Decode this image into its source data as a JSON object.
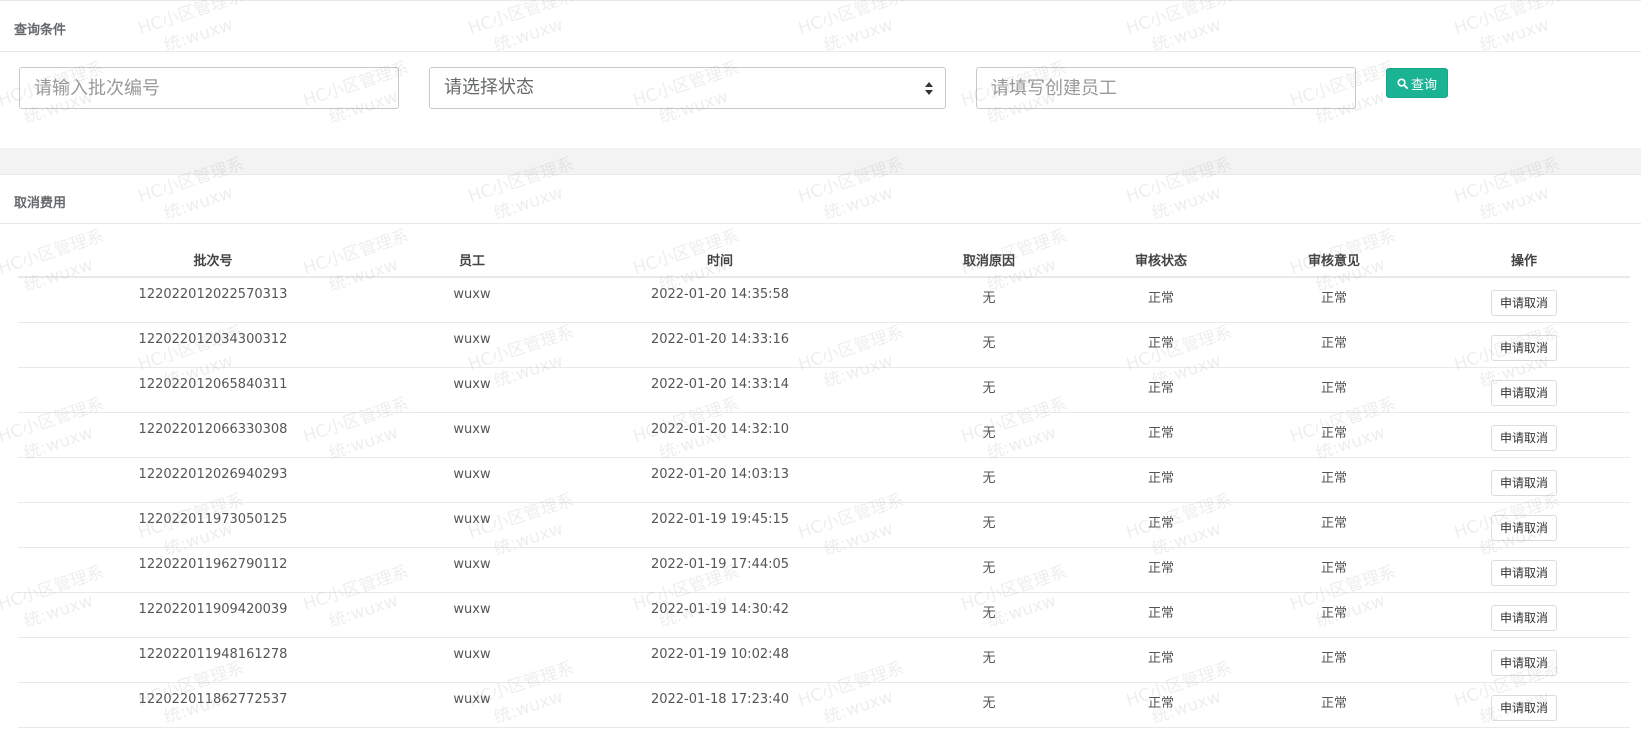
{
  "query_panel": {
    "title": "查询条件",
    "batch_placeholder": "请输入批次编号",
    "status_placeholder": "请选择状态",
    "creator_placeholder": "请填写创建员工",
    "query_button": "查询"
  },
  "cancel_panel": {
    "title": "取消费用",
    "columns": [
      "批次号",
      "员工",
      "时间",
      "取消原因",
      "审核状态",
      "审核意见",
      "操作"
    ],
    "rows": [
      {
        "batch": "122022012022570313",
        "staff": "wuxw",
        "time": "2022-01-20 14:35:58",
        "reason": "无",
        "status": "正常",
        "opinion": "正常",
        "action": "申请取消"
      },
      {
        "batch": "122022012034300312",
        "staff": "wuxw",
        "time": "2022-01-20 14:33:16",
        "reason": "无",
        "status": "正常",
        "opinion": "正常",
        "action": "申请取消"
      },
      {
        "batch": "122022012065840311",
        "staff": "wuxw",
        "time": "2022-01-20 14:33:14",
        "reason": "无",
        "status": "正常",
        "opinion": "正常",
        "action": "申请取消"
      },
      {
        "batch": "122022012066330308",
        "staff": "wuxw",
        "time": "2022-01-20 14:32:10",
        "reason": "无",
        "status": "正常",
        "opinion": "正常",
        "action": "申请取消"
      },
      {
        "batch": "122022012026940293",
        "staff": "wuxw",
        "time": "2022-01-20 14:03:13",
        "reason": "无",
        "status": "正常",
        "opinion": "正常",
        "action": "申请取消"
      },
      {
        "batch": "122022011973050125",
        "staff": "wuxw",
        "time": "2022-01-19 19:45:15",
        "reason": "无",
        "status": "正常",
        "opinion": "正常",
        "action": "申请取消"
      },
      {
        "batch": "122022011962790112",
        "staff": "wuxw",
        "time": "2022-01-19 17:44:05",
        "reason": "无",
        "status": "正常",
        "opinion": "正常",
        "action": "申请取消"
      },
      {
        "batch": "122022011909420039",
        "staff": "wuxw",
        "time": "2022-01-19 14:30:42",
        "reason": "无",
        "status": "正常",
        "opinion": "正常",
        "action": "申请取消"
      },
      {
        "batch": "122022011948161278",
        "staff": "wuxw",
        "time": "2022-01-19 10:02:48",
        "reason": "无",
        "status": "正常",
        "opinion": "正常",
        "action": "申请取消"
      },
      {
        "batch": "122022011862772537",
        "staff": "wuxw",
        "time": "2022-01-18 17:23:40",
        "reason": "无",
        "status": "正常",
        "opinion": "正常",
        "action": "申请取消"
      }
    ]
  },
  "watermark": {
    "line1": "HC小区管理系",
    "line2": "统:wuxw"
  },
  "colors": {
    "primary": "#1ab394",
    "border": "#e7eaec",
    "band": "#f3f3f4"
  },
  "icons": {
    "query_button": "search-icon",
    "status_select": "select-arrows-icon"
  }
}
